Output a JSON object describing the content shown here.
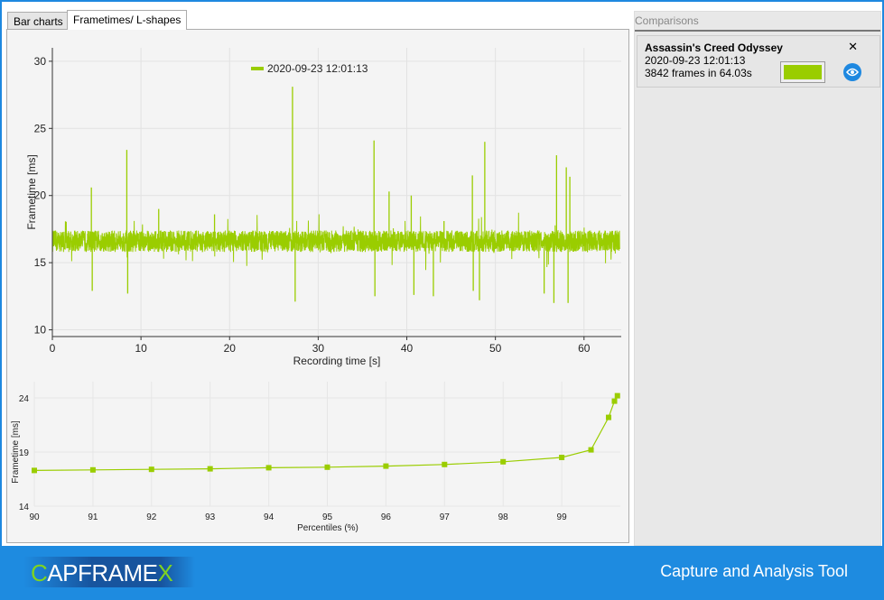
{
  "tabs": [
    {
      "label": "Bar charts",
      "active": false
    },
    {
      "label": "Frametimes/ L-shapes",
      "active": true
    }
  ],
  "comparisons": {
    "title": "Comparisons",
    "items": [
      {
        "game": "Assassin's Creed Odyssey",
        "date": "2020-09-23 12:01:13",
        "summary": "3842 frames in 64.03s",
        "color": "#9acd00"
      }
    ]
  },
  "footer": {
    "logo_pre": "C",
    "logo_mid": "APFRAME",
    "logo_post": "X",
    "tagline": "Capture and Analysis Tool"
  },
  "chart_data": [
    {
      "type": "line",
      "title": "",
      "legend": "2020-09-23 12:01:13",
      "legend_position": "top-center",
      "xlabel": "Recording time [s]",
      "ylabel": "Frametime [ms]",
      "xlim": [
        0,
        64.03
      ],
      "ylim": [
        9.5,
        31
      ],
      "xticks": [
        0,
        10,
        20,
        30,
        40,
        50,
        60
      ],
      "yticks": [
        10,
        15,
        20,
        25,
        30
      ],
      "color": "#9acd00",
      "baseline_ms": 16.6,
      "noise_ms": 0.8,
      "frames": 3842,
      "spikes": [
        [
          4.4,
          20.6
        ],
        [
          4.5,
          12.9
        ],
        [
          8.4,
          23.4
        ],
        [
          8.5,
          12.7
        ],
        [
          12.0,
          19.0
        ],
        [
          18.3,
          18.6
        ],
        [
          27.1,
          28.1
        ],
        [
          27.4,
          12.1
        ],
        [
          36.3,
          24.1
        ],
        [
          36.4,
          12.5
        ],
        [
          38.0,
          20.3
        ],
        [
          40.5,
          20.0
        ],
        [
          40.8,
          12.6
        ],
        [
          43.0,
          12.5
        ],
        [
          44.2,
          18.1
        ],
        [
          47.4,
          21.5
        ],
        [
          47.5,
          12.9
        ],
        [
          48.2,
          12.2
        ],
        [
          48.8,
          24.0
        ],
        [
          55.5,
          12.7
        ],
        [
          56.6,
          12.0
        ],
        [
          56.9,
          23.0
        ],
        [
          58.0,
          22.1
        ],
        [
          58.2,
          12.0
        ],
        [
          58.4,
          21.4
        ]
      ]
    },
    {
      "type": "line",
      "title": "",
      "xlabel": "Percentiles (%)",
      "ylabel": "Frametime [ms]",
      "xlim": [
        90,
        100
      ],
      "ylim": [
        14,
        25
      ],
      "xticks": [
        90,
        91,
        92,
        93,
        94,
        95,
        96,
        97,
        98,
        99
      ],
      "yticks": [
        14,
        19,
        24
      ],
      "color": "#9acd00",
      "x": [
        90,
        91,
        92,
        93,
        94,
        95,
        96,
        97,
        98,
        99,
        99.5,
        99.8,
        99.9,
        99.95
      ],
      "y": [
        17.3,
        17.35,
        17.4,
        17.45,
        17.55,
        17.6,
        17.7,
        17.85,
        18.1,
        18.5,
        19.2,
        22.2,
        23.7,
        24.2
      ]
    }
  ]
}
